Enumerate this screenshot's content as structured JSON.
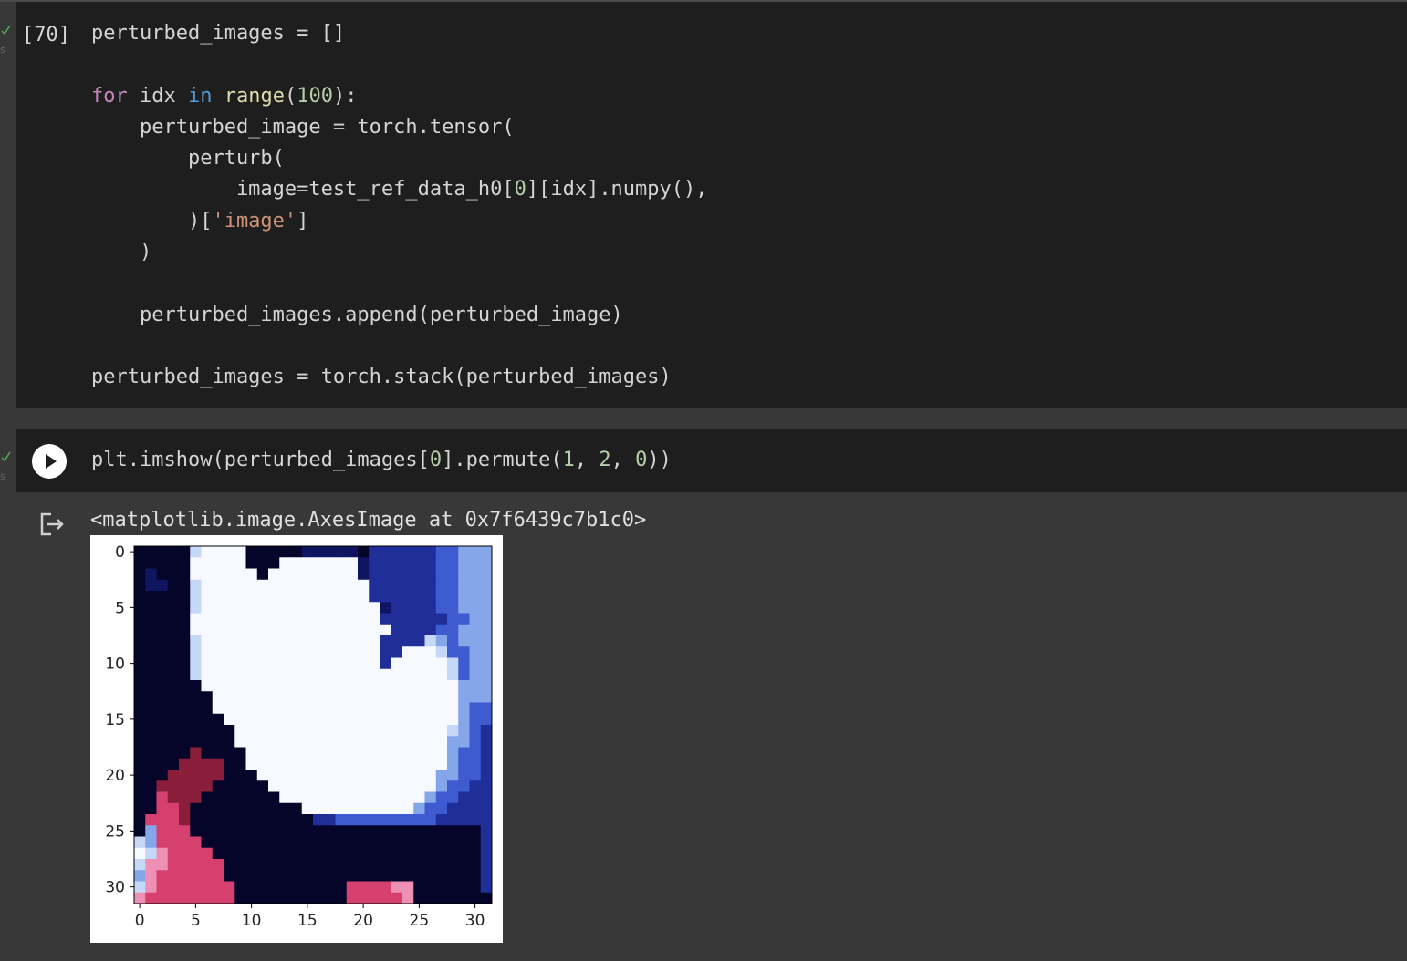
{
  "cell1": {
    "exec_count": "[70]",
    "lines": [
      [
        {
          "t": "perturbed_images = []",
          "c": ""
        }
      ],
      [],
      [
        {
          "t": "for",
          "c": "kw"
        },
        {
          "t": " idx ",
          "c": ""
        },
        {
          "t": "in",
          "c": "kw2"
        },
        {
          "t": " ",
          "c": ""
        },
        {
          "t": "range",
          "c": "fn"
        },
        {
          "t": "(",
          "c": ""
        },
        {
          "t": "100",
          "c": "num"
        },
        {
          "t": "):",
          "c": ""
        }
      ],
      [
        {
          "t": "    perturbed_image = torch.tensor(",
          "c": ""
        }
      ],
      [
        {
          "t": "        perturb(",
          "c": ""
        }
      ],
      [
        {
          "t": "            image=test_ref_data_h0[",
          "c": ""
        },
        {
          "t": "0",
          "c": "num"
        },
        {
          "t": "][idx].numpy(),",
          "c": ""
        }
      ],
      [
        {
          "t": "        )[",
          "c": ""
        },
        {
          "t": "'image'",
          "c": "str"
        },
        {
          "t": "]",
          "c": ""
        }
      ],
      [
        {
          "t": "    )",
          "c": ""
        }
      ],
      [],
      [
        {
          "t": "    perturbed_images.append(perturbed_image)",
          "c": ""
        }
      ],
      [],
      [
        {
          "t": "perturbed_images = torch.stack(perturbed_images)",
          "c": ""
        }
      ]
    ]
  },
  "cell2": {
    "lines": [
      [
        {
          "t": "plt.imshow(perturbed_images[",
          "c": ""
        },
        {
          "t": "0",
          "c": "num"
        },
        {
          "t": "].permute(",
          "c": ""
        },
        {
          "t": "1",
          "c": "num"
        },
        {
          "t": ", ",
          "c": ""
        },
        {
          "t": "2",
          "c": "num"
        },
        {
          "t": ", ",
          "c": ""
        },
        {
          "t": "0",
          "c": "num"
        },
        {
          "t": "))",
          "c": ""
        }
      ]
    ]
  },
  "output": {
    "text": "<matplotlib.image.AxesImage at 0x7f6439c7b1c0>"
  },
  "plot": {
    "xticks": [
      "0",
      "5",
      "10",
      "15",
      "20",
      "25",
      "30"
    ],
    "yticks": [
      "0",
      "5",
      "10",
      "15",
      "20",
      "25",
      "30"
    ],
    "palette": {
      "K": "#05052a",
      "N": "#0f1560",
      "D": "#1f2e99",
      "B": "#3f5bd0",
      "L": "#86a6ea",
      "P": "#c6d8f7",
      "W": "#f6f9ff",
      "R": "#8a1e3a",
      "M": "#d6406f",
      "I": "#ee8fb4"
    },
    "pixels": [
      "KKKKKPWWWWKKKKKNNNNNKDDDDDDBBLLL",
      "KKKKKWWWWWKKKWWWWWWWNDDDDDDBBLLL",
      "KNKKKWWWWWWKWWWWWWWWNDDDDDDBBLLL",
      "KNNKKPWWWWWWWWWWWWWWWDDDDDDBBLLL",
      "KKKKKPWWWWWWWWWWWWWWWDDDDDDBBLLL",
      "KKKKKPWWWWWWWWWWWWWWWWNDDDDBBLLL",
      "KKKKKWWWWWWWWWWWWWWWWWDDDDDDBBLL",
      "KKKKKWWWWWWWWWWWWWWWWWWDDDDBBLLL",
      "KKKKKPWWWWWWWWWWWWWWWWDDDDPLBLLL",
      "KKKKKPWWWWWWWWWWWWWWWWDDWWWPBBLL",
      "KKKKKPWWWWWWWWWWWWWWWWDWWWWWPBLL",
      "KKKKKPWWWWWWWWWWWWWWWWWWWWWWPBLL",
      "KKKKKKWWWWWWWWWWWWWWWWWWWWWWWLLL",
      "KKKKKKKWWWWWWWWWWWWWWWWWWWWWWLLL",
      "KKKKKKKWWWWWWWWWWWWWWWWWWWWWWLBB",
      "KKKKKKKKWWWWWWWWWWWWWWWWWWWWWLBB",
      "KKKKKKKKKWWWWWWWWWWWWWWWWWWWPLBD",
      "KKKKKKKKKWWWWWWWWWWWWWWWWWWWLLBD",
      "KKKKKRKKKKWWWWWWWWWWWWWWWWWWLBBD",
      "KKKKRRRRKKWWWWWWWWWWWWWWWWWWLBBD",
      "KKKRRRRRKKKWWWWWWWWWWWWWWWWLLBBD",
      "KKRRRRRKKKKKWWWWWWWWWWWWWWWLBBDD",
      "KKMRRRKKKKKKKWWWWWWWWWWWWWLBBDDD",
      "KKMMRKKKKKKKKKKWWWWWWWWWWLBBDDDD",
      "KMMMRKKKKKKKKKKKDDBBBBBBBBBDDDDD",
      "KLMMMKKKKKKKKKKKKKKKKKKKKKKKKKKD",
      "PLMMMMKKKKKKKKKKKKKKKKKKKKKKKKKD",
      "WPIMMMMKKKKKKKKKKKKKKKKKKKKKKKKD",
      "PIIMMMMMKKKKKKKKKKKKKKKKKKKKKKKD",
      "LIMMMMMMKKKKKKKKKKKKKKKKKKKKKKKD",
      "PIMMMMMMMKKKKKKKKKKMMMMIIKKKKKKD",
      "IMMMMMMMMKKKKKKKKKKMMMMMIKKKKKKK"
    ]
  }
}
